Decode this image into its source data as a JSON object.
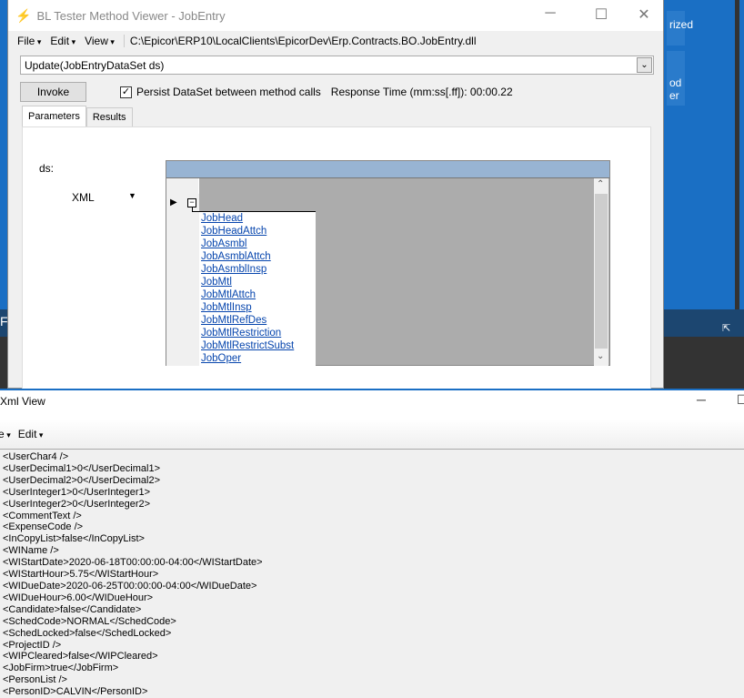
{
  "desktop": {
    "tile1": "rized",
    "tile2a": "od",
    "tile2b": "er",
    "band_letter": "F"
  },
  "main": {
    "title": "BL Tester Method Viewer - JobEntry",
    "menus": [
      "File",
      "Edit",
      "View"
    ],
    "path": "C:\\Epicor\\ERP10\\LocalClients\\EpicorDev\\Erp.Contracts.BO.JobEntry.dll",
    "method": "Update(JobEntryDataSet ds)",
    "invoke_label": "Invoke",
    "persist_label": "Persist DataSet between method calls",
    "persist_checked": true,
    "response_time": "Response Time (mm:ss[.ff]): 00:00.22",
    "tabs": [
      "Parameters",
      "Results"
    ],
    "param_label": "ds:",
    "format": "XML",
    "tables": [
      "JobHead",
      "JobHeadAttch",
      "JobAsmbl",
      "JobAsmblAttch",
      "JobAsmblInsp",
      "JobMtl",
      "JobMtlAttch",
      "JobMtlInsp",
      "JobMtlRefDes",
      "JobMtlRestriction",
      "JobMtlRestrictSubst",
      "JobOper"
    ]
  },
  "xml": {
    "title": "Xml View",
    "menus": [
      "e",
      "Edit"
    ],
    "lines": [
      "<UserChar4 />",
      "<UserDecimal1>0</UserDecimal1>",
      "<UserDecimal2>0</UserDecimal2>",
      "<UserInteger1>0</UserInteger1>",
      "<UserInteger2>0</UserInteger2>",
      "<CommentText />",
      "<ExpenseCode />",
      "<InCopyList>false</InCopyList>",
      "<WIName />",
      "<WIStartDate>2020-06-18T00:00:00-04:00</WIStartDate>",
      "<WIStartHour>5.75</WIStartHour>",
      "<WIDueDate>2020-06-25T00:00:00-04:00</WIDueDate>",
      "<WIDueHour>6.00</WIDueHour>",
      "<Candidate>false</Candidate>",
      "<SchedCode>NORMAL</SchedCode>",
      "<SchedLocked>false</SchedLocked>",
      "<ProjectID />",
      "<WIPCleared>false</WIPCleared>",
      "<JobFirm>true</JobFirm>",
      "<PersonList />",
      "<PersonID>CALVIN</PersonID>"
    ]
  }
}
